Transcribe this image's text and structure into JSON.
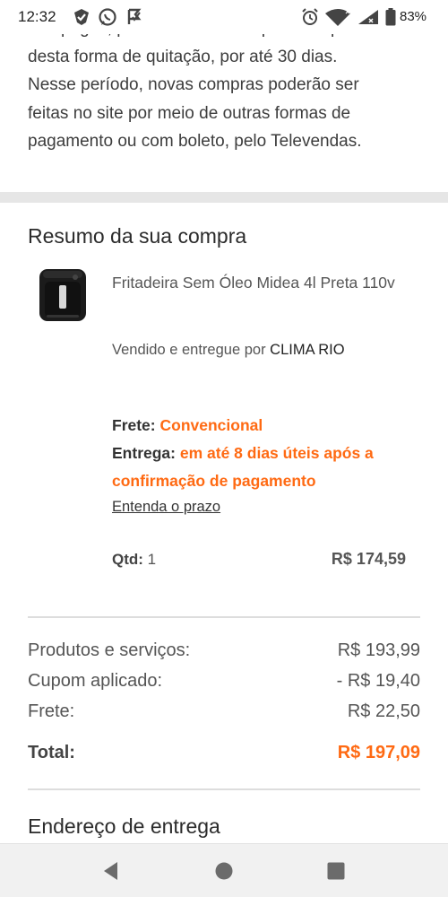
{
  "status_bar": {
    "time": "12:32",
    "battery_percent": "83%",
    "left_icons": [
      "checked-pin-icon",
      "whatsapp-icon",
      "app-notification-icon"
    ],
    "right_icons": [
      "alarm-icon",
      "wifi-icon",
      "signal-icon",
      "battery-icon"
    ]
  },
  "payment_notice": {
    "lines": [
      "não pagos, poderá ocorrer bloqueio temporário",
      "desta forma de quitação, por até 30 dias.",
      "Nesse período, novas compras poderão ser",
      "feitas no site por meio de outras formas de",
      "pagamento ou com boleto, pelo Televendas."
    ]
  },
  "order_summary": {
    "title": "Resumo da sua compra",
    "product": {
      "name": "Fritadeira Sem Óleo Midea 4l Preta 110v",
      "sold_by_prefix": "Vendido e entregue por",
      "seller": "CLIMA RIO",
      "shipping_label": "Frete:",
      "shipping_value": "Convencional",
      "delivery_label": "Entrega:",
      "delivery_value_line1": "em até 8 dias úteis após a",
      "delivery_value_line2": "confirmação de pagamento",
      "deadline_link": "Entenda o prazo",
      "qty_label": "Qtd:",
      "qty_value": "1",
      "price": "R$ 174,59"
    },
    "totals": {
      "products_label": "Produtos e serviços:",
      "products_value": "R$ 193,99",
      "coupon_label": "Cupom aplicado:",
      "coupon_value": "- R$ 19,40",
      "shipping_label": "Frete:",
      "shipping_value": "R$ 22,50",
      "total_label": "Total:",
      "total_value": "R$ 197,09"
    }
  },
  "delivery_address": {
    "title": "Endereço de entrega"
  },
  "nav_bar": {
    "buttons": [
      "back-icon",
      "home-icon",
      "recents-icon"
    ]
  },
  "colors": {
    "accent": "#ff6a13",
    "text": "#555555",
    "divider": "#e6e6e6"
  }
}
